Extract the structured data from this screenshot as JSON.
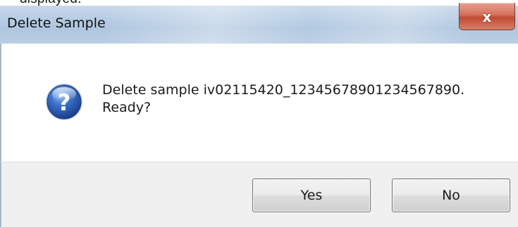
{
  "doc_fragment": "displayed.",
  "window": {
    "title": "Delete Sample",
    "close_glyph": "x"
  },
  "dialog": {
    "icon": "question-icon",
    "message_line1": "Delete sample iv02115420_12345678901234567890.",
    "message_line2": "Ready?"
  },
  "buttons": {
    "yes_label": "Yes",
    "no_label": "No"
  },
  "colors": {
    "titlebar": "#b7cde4",
    "close_button": "#c24a33",
    "footer": "#f0f0f0",
    "icon_blue": "#2c5fb8"
  }
}
